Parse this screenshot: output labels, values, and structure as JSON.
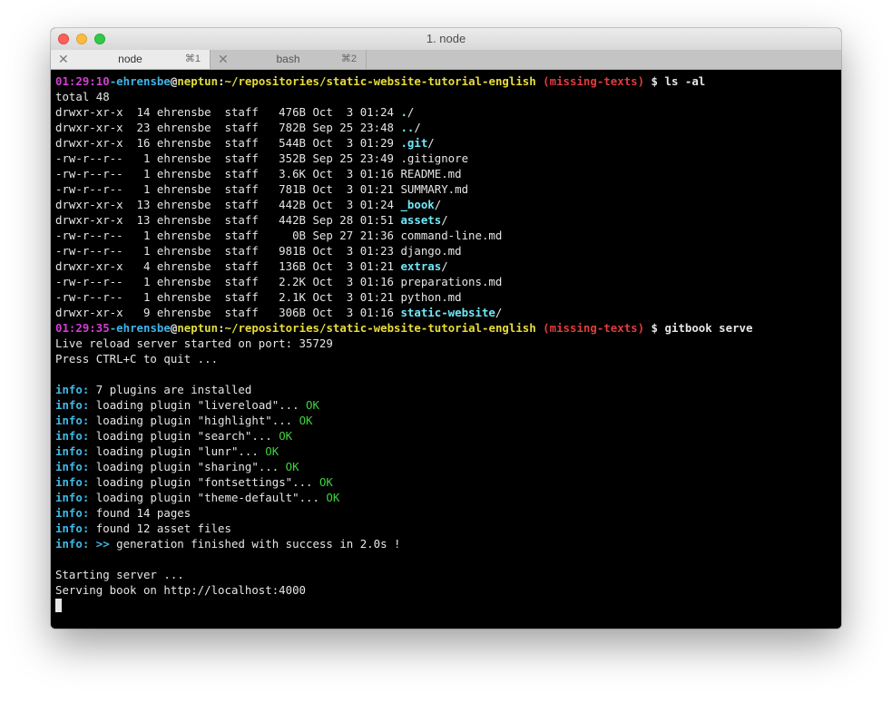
{
  "window": {
    "title": "1. node",
    "tabs": [
      {
        "close": "✕",
        "label": "node",
        "shortcut": "⌘1"
      },
      {
        "close": "✕",
        "label": "bash",
        "shortcut": "⌘2"
      }
    ]
  },
  "colors": {
    "time": "#d23fd1",
    "user": "#3fb4e8",
    "host": "#e0dc3f",
    "path": "#e8dc3a",
    "branch": "#e03c3c",
    "directory": "#6fe8f8",
    "info": "#3fb9e6",
    "ok": "#3fd33f"
  },
  "prompt1": {
    "time": "01:29:10",
    "dash": "-",
    "user": "ehrensbe",
    "at": "@",
    "host": "neptun",
    "sep": ":",
    "path": "~/repositories/static-website-tutorial-english",
    "branch": "(missing-texts)",
    "dollar": "$",
    "command": "ls -al"
  },
  "ls": {
    "total": "total 48",
    "rows": [
      {
        "meta": "drwxr-xr-x  14 ehrensbe  staff   476B Oct  3 01:24 ",
        "name": ".",
        "suffix": "/",
        "dir": true
      },
      {
        "meta": "drwxr-xr-x  23 ehrensbe  staff   782B Sep 25 23:48 ",
        "name": "..",
        "suffix": "/",
        "dir": true
      },
      {
        "meta": "drwxr-xr-x  16 ehrensbe  staff   544B Oct  3 01:29 ",
        "name": ".git",
        "suffix": "/",
        "dir": true
      },
      {
        "meta": "-rw-r--r--   1 ehrensbe  staff   352B Sep 25 23:49 ",
        "name": ".gitignore",
        "suffix": "",
        "dir": false
      },
      {
        "meta": "-rw-r--r--   1 ehrensbe  staff   3.6K Oct  3 01:16 ",
        "name": "README.md",
        "suffix": "",
        "dir": false
      },
      {
        "meta": "-rw-r--r--   1 ehrensbe  staff   781B Oct  3 01:21 ",
        "name": "SUMMARY.md",
        "suffix": "",
        "dir": false
      },
      {
        "meta": "drwxr-xr-x  13 ehrensbe  staff   442B Oct  3 01:24 ",
        "name": "_book",
        "suffix": "/",
        "dir": true
      },
      {
        "meta": "drwxr-xr-x  13 ehrensbe  staff   442B Sep 28 01:51 ",
        "name": "assets",
        "suffix": "/",
        "dir": true
      },
      {
        "meta": "-rw-r--r--   1 ehrensbe  staff     0B Sep 27 21:36 ",
        "name": "command-line.md",
        "suffix": "",
        "dir": false
      },
      {
        "meta": "-rw-r--r--   1 ehrensbe  staff   981B Oct  3 01:23 ",
        "name": "django.md",
        "suffix": "",
        "dir": false
      },
      {
        "meta": "drwxr-xr-x   4 ehrensbe  staff   136B Oct  3 01:21 ",
        "name": "extras",
        "suffix": "/",
        "dir": true
      },
      {
        "meta": "-rw-r--r--   1 ehrensbe  staff   2.2K Oct  3 01:16 ",
        "name": "preparations.md",
        "suffix": "",
        "dir": false
      },
      {
        "meta": "-rw-r--r--   1 ehrensbe  staff   2.1K Oct  3 01:21 ",
        "name": "python.md",
        "suffix": "",
        "dir": false
      },
      {
        "meta": "drwxr-xr-x   9 ehrensbe  staff   306B Oct  3 01:16 ",
        "name": "static-website",
        "suffix": "/",
        "dir": true
      }
    ]
  },
  "prompt2": {
    "time": "01:29:35",
    "dash": "-",
    "user": "ehrensbe",
    "at": "@",
    "host": "neptun",
    "sep": ":",
    "path": "~/repositories/static-website-tutorial-english",
    "branch": "(missing-texts)",
    "dollar": "$",
    "command": "gitbook serve"
  },
  "serve": {
    "live_reload": "Live reload server started on port: 35729",
    "quit": "Press CTRL+C to quit ...",
    "info_prefix": "info:",
    "info_lines": [
      {
        "text": "7 plugins are installed",
        "ok": ""
      },
      {
        "text": "loading plugin \"livereload\"... ",
        "ok": "OK"
      },
      {
        "text": "loading plugin \"highlight\"... ",
        "ok": "OK"
      },
      {
        "text": "loading plugin \"search\"... ",
        "ok": "OK"
      },
      {
        "text": "loading plugin \"lunr\"... ",
        "ok": "OK"
      },
      {
        "text": "loading plugin \"sharing\"... ",
        "ok": "OK"
      },
      {
        "text": "loading plugin \"fontsettings\"... ",
        "ok": "OK"
      },
      {
        "text": "loading plugin \"theme-default\"... ",
        "ok": "OK"
      },
      {
        "text": "found 14 pages",
        "ok": ""
      },
      {
        "text": "found 12 asset files",
        "ok": ""
      }
    ],
    "generation_arrow": ">>",
    "generation_text": " generation finished with success in 2.0s !",
    "starting": "Starting server ...",
    "serving": "Serving book on http://localhost:4000"
  }
}
